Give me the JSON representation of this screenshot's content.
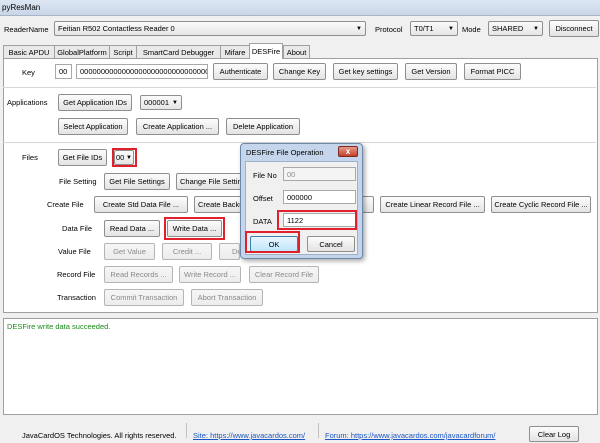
{
  "window": {
    "title": "pyResMan"
  },
  "reader": {
    "label": "ReaderName",
    "value": "Feitian R502 Contactless Reader 0",
    "protocol_label": "Protocol",
    "protocol_value": "T0/T1",
    "mode_label": "Mode",
    "mode_value": "SHARED",
    "disconnect_label": "Disconnect"
  },
  "tabs": [
    {
      "label": "Basic APDU"
    },
    {
      "label": "GlobalPlatform"
    },
    {
      "label": "Script"
    },
    {
      "label": "SmartCard Debugger"
    },
    {
      "label": "Mifare"
    },
    {
      "label": "DESFire"
    },
    {
      "label": "About"
    }
  ],
  "key_section": {
    "label": "Key",
    "key_no": "00",
    "key_value": "00000000000000000000000000000000",
    "authenticate": "Authenticate",
    "change_key": "Change Key",
    "get_key_settings": "Get key settings",
    "get_version": "Get Version",
    "format_picc": "Format PICC"
  },
  "applications": {
    "label": "Applications",
    "get_ids": "Get Application IDs",
    "selected_id": "000001",
    "select": "Select Application",
    "create": "Create Application ...",
    "delete": "Delete Application"
  },
  "files": {
    "label": "Files",
    "get_file_ids": "Get File IDs",
    "file_id": "00",
    "file_setting_label": "File Setting",
    "get_file_settings": "Get File Settings",
    "change_file_settings": "Change File Settings ...",
    "create_file_label": "Create File",
    "create_std": "Create Std Data File ...",
    "create_backup": "Create Backup Data File ...",
    "create_value": "Create Value File ...",
    "create_linear": "Create Linear Record File ...",
    "create_cyclic": "Create Cyclic Record File ...",
    "data_file_label": "Data File",
    "read_data": "Read Data ...",
    "write_data": "Write Data ...",
    "value_file_label": "Value File",
    "get_value": "Get Value",
    "credit": "Credit ...",
    "debit": "Debit ...",
    "record_file_label": "Record File",
    "read_records": "Read Records ...",
    "write_record": "Write Record ...",
    "clear_record": "Clear Record File",
    "transaction_label": "Transaction",
    "commit": "Commit Transaction",
    "abort": "Abort Transaction"
  },
  "dialog": {
    "title": "DESFire File Operation",
    "close": "x",
    "file_no_label": "File No",
    "file_no_value": "00",
    "offset_label": "Offset",
    "offset_value": "000000",
    "data_label": "DATA",
    "data_value": "1122",
    "ok": "OK",
    "cancel": "Cancel"
  },
  "log": {
    "message": "DESFire write data succeeded."
  },
  "status": {
    "copyright": "JavaCardOS Technologies. All rights reserved.",
    "site": "Site: https://www.javacardos.com/",
    "forum": "Forum: https://www.javacardos.com/javacardforum/",
    "clear_log": "Clear Log"
  },
  "colors": {
    "highlight": "#e0202a",
    "log_text": "#1a8a1a",
    "link": "#1a56c4"
  }
}
